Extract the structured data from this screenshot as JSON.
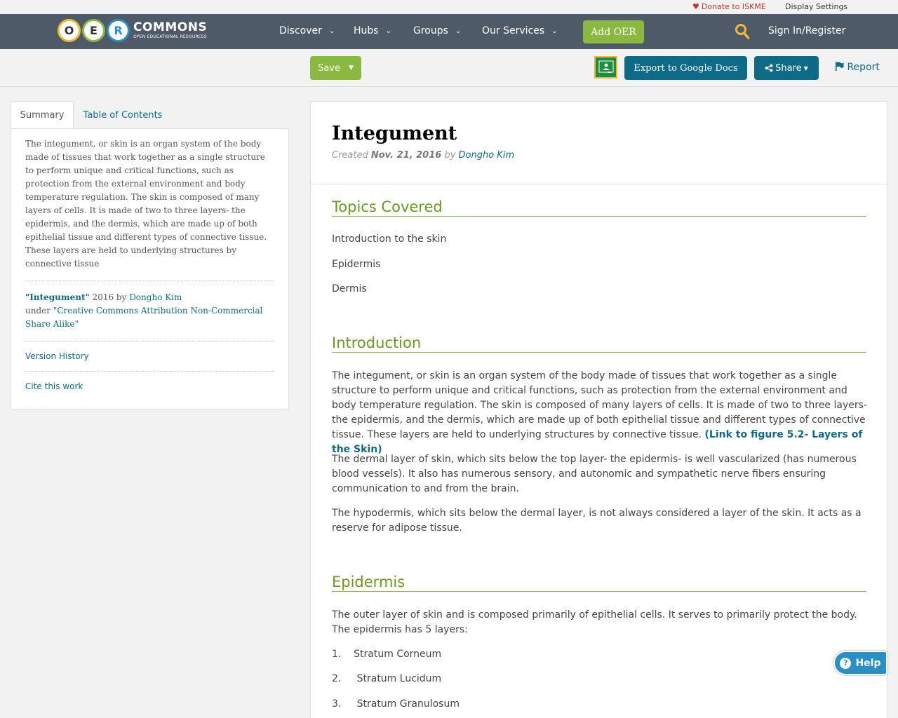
{
  "utility": {
    "donate": "Donate to ISKME",
    "display_settings": "Display Settings"
  },
  "logo": {
    "letters": [
      "O",
      "E",
      "R"
    ],
    "wordmark": "COMMONS",
    "tagline": "OPEN EDUCATIONAL RESOURCES"
  },
  "nav": {
    "items": [
      "Discover",
      "Hubs",
      "Groups",
      "Our Services"
    ],
    "add_oer": "Add OER",
    "sign_in": "Sign In/Register"
  },
  "toolbar": {
    "save": "Save",
    "export": "Export to Google Docs",
    "share": "Share",
    "report": "Report"
  },
  "sidebar": {
    "tabs": [
      "Summary",
      "Table of Contents"
    ],
    "summary": "The integument, or skin is an organ system of the body made of tissues that work together as a single structure to perform unique and critical functions, such as protection from the external environment and body temperature regulation. The skin is composed of many layers of cells. It is made of two to three layers- the epidermis, and the dermis, which are made up of both epithelial tissue and different types of connective tissue. These layers are held to underlying structures by connective tissue",
    "attribution": {
      "title": "\"Integument\"",
      "year_by": " 2016 by ",
      "author": "Dongho Kim",
      "under": "under ",
      "license": "\"Creative Commons Attribution Non-Commercial Share Alike\""
    },
    "version_history": "Version History",
    "cite": "Cite this work"
  },
  "main": {
    "title": "Integument",
    "created_label": "Created ",
    "created_date": "Nov. 21, 2016",
    "by_label": " by ",
    "author": "Dongho Kim",
    "topics_title": "Topics Covered",
    "topics": [
      "Introduction to the skin",
      "Epidermis",
      "Dermis"
    ],
    "intro_title": "Introduction",
    "intro_p1": "The integument, or skin is an organ system of the body made of tissues that work together as a single structure to perform unique and critical functions, such as protection from the external environment and body temperature regulation. The skin is composed of many layers of cells. It is made of two to three layers- the epidermis, and the dermis, which are made up of both epithelial tissue and different types of connective tissue.  These layers are held to underlying structures by connective tissue. ",
    "intro_link": "(Link to figure 5.2- Layers of the Skin)",
    "intro_p2": "The dermal layer of skin, which sits below the top layer- the epidermis- is well vascularized (has numerous blood vessels). It also has numerous sensory, and autonomic and sympathetic nerve fibers ensuring communication to and from the brain.",
    "intro_p3": "The hypodermis, which sits below the dermal layer, is not always considered a layer of the skin. It acts as a reserve for adipose tissue.",
    "epi_title": "Epidermis",
    "epi_p1": "The outer layer of skin and is composed primarily of epithelial cells. It serves to primarily protect the body.  The epidermis has 5 layers:",
    "epi_layers": [
      "1.    Stratum Corneum",
      "2.     Stratum Lucidum",
      "3.     Stratum Granulosum"
    ]
  },
  "help": "Help",
  "colors": {
    "nav_bg": "#4f5a69",
    "green": "#8ab93f",
    "teal": "#0e6b88",
    "section_green": "#6a9a1f"
  }
}
